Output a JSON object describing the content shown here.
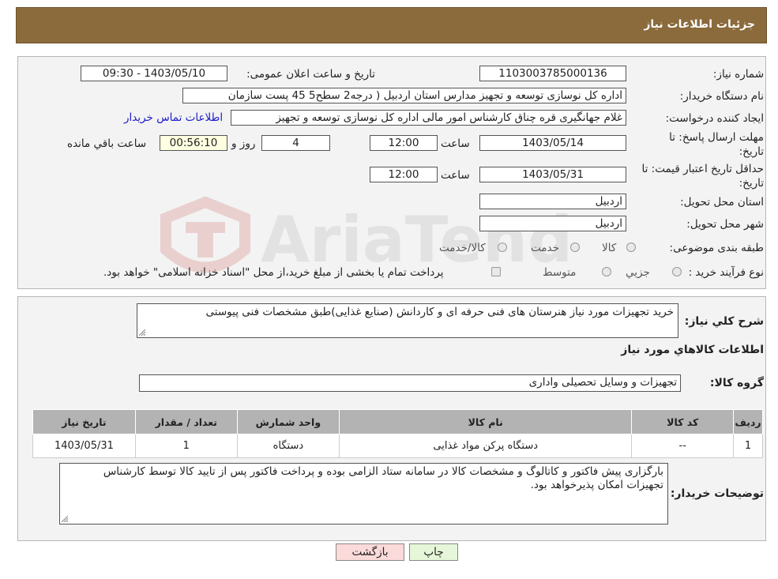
{
  "header": {
    "title": "جزئیات اطلاعات نیاز"
  },
  "form": {
    "need_number_label": "شماره نیاز:",
    "need_number": "1103003785000136",
    "announce_label": "تاریخ و ساعت اعلان عمومی:",
    "announce_value": "1403/05/10 - 09:30",
    "buyer_org_label": "نام دستگاه خریدار:",
    "buyer_org": "اداره کل نوسازی   توسعه و تجهیز مدارس استان اردبیل ( درجه2  سطح5  45 پست سازمان",
    "requester_label": "ایجاد کننده درخواست:",
    "requester": "غلام جهانگیری قره چناق کارشناس امور مالی اداره کل نوسازی   توسعه و تجهیز",
    "contact_link": "اطلاعات تماس خریدار",
    "deadline_label_1": "مهلت ارسال پاسخ: تا",
    "deadline_label_2": "تاریخ:",
    "deadline_date": "1403/05/14",
    "time_label": "ساعت",
    "deadline_time": "12:00",
    "days_value": "4",
    "days_label": "روز و",
    "remaining_value": "00:56:10",
    "remaining_label": "ساعت باقي مانده",
    "validity_label_1": "حداقل تاریخ اعتبار قیمت: تا",
    "validity_label_2": "تاریخ:",
    "validity_date": "1403/05/31",
    "validity_time": "12:00",
    "province_label": "استان محل تحویل:",
    "province": "اردبیل",
    "city_label": "شهر محل تحویل:",
    "city": "اردبیل",
    "category_label": "طبقه بندی موضوعی:",
    "category_options": [
      "کالا",
      "خدمت",
      "کالا/خدمت"
    ],
    "process_label": "نوع فرآیند خرید :",
    "process_options": [
      "جزیي",
      "متوسط"
    ],
    "process_note": "پرداخت تمام یا بخشی از مبلغ خرید،از محل \"اسناد خزانه اسلامی\" خواهد بود."
  },
  "details": {
    "summary_label": "شرح كلي نياز:",
    "summary": "خرید تجهیزات مورد نیاز هنرستان های فنی حرفه ای و کاردانش (صنایع غذایی)طبق مشخصات فنی پیوستی",
    "goods_title": "اطلاعات كالاهاي مورد نياز",
    "group_label": "گروه کالا:",
    "group": "تجهیزات و وسایل تحصیلی واداری",
    "table": {
      "headers": [
        "ردیف",
        "کد کالا",
        "نام کالا",
        "واحد شمارش",
        "تعداد / مقدار",
        "تاریخ نیاز"
      ],
      "rows": [
        [
          "1",
          "--",
          "دستگاه پرکن مواد غذایی",
          "دستگاه",
          "1",
          "1403/05/31"
        ]
      ]
    },
    "notes_label": "توضیحات خریدار:",
    "notes": "بارگزاری پیش فاکتور و کاتالوگ و مشخصات کالا در سامانه ستاد الزامی بوده و پرداخت فاکتور پس از تایید کالا توسط کارشناس تجهیزات امکان پذیرخواهد بود."
  },
  "buttons": {
    "print": "چاپ",
    "back": "بازگشت"
  },
  "colors": {
    "header_bg": "#8b6a3c",
    "back_btn_bg": "#fbdada",
    "print_btn_bg": "#e6f7d9",
    "link": "#1a1acc"
  }
}
